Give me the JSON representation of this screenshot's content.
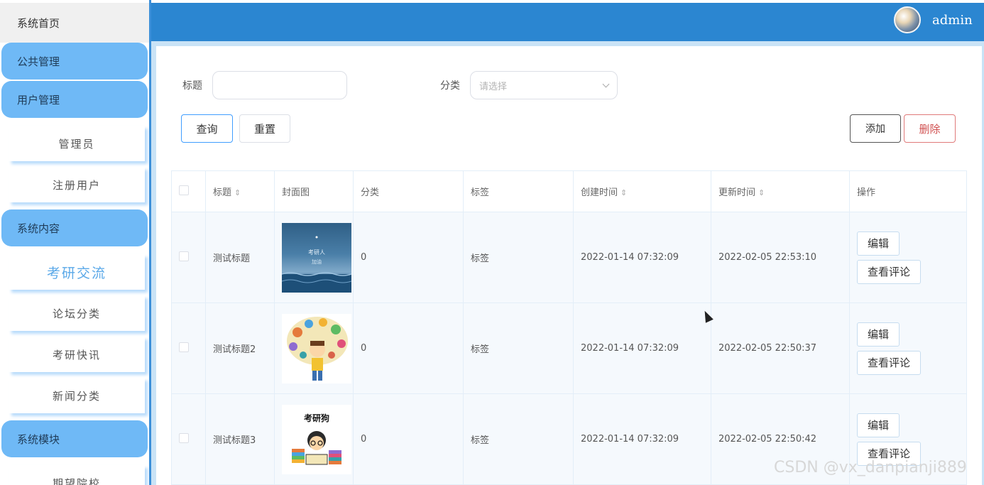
{
  "sidebar": {
    "home": "系统首页",
    "groups": {
      "public": "公共管理",
      "user": "用户管理",
      "content": "系统内容",
      "module": "系统模块"
    },
    "subs": {
      "admin": "管理员",
      "registered": "注册用户",
      "exchange": "考研交流",
      "forum_category": "论坛分类",
      "news_flash": "考研快讯",
      "news_category": "新闻分类",
      "target_school": "期望院校"
    }
  },
  "header": {
    "username": "admin"
  },
  "search": {
    "title_label": "标题",
    "title_value": "",
    "category_label": "分类",
    "category_placeholder": "请选择"
  },
  "toolbar": {
    "query": "查询",
    "reset": "重置",
    "add": "添加",
    "delete": "删除"
  },
  "table": {
    "headers": {
      "title": "标题",
      "cover": "封面图",
      "category": "分类",
      "tags": "标签",
      "created": "创建时间",
      "updated": "更新时间",
      "actions": "操作"
    },
    "sort_glyph": "⇕",
    "rows": [
      {
        "title": "测试标题",
        "cover_text": "考研人",
        "cover_sub": "加油",
        "category": "0",
        "tags": "标签",
        "created": "2022-01-14 07:32:09",
        "updated": "2022-02-05 22:53:10",
        "edit": "编辑",
        "view_comments": "查看评论"
      },
      {
        "title": "测试标题2",
        "category": "0",
        "tags": "标签",
        "created": "2022-01-14 07:32:09",
        "updated": "2022-02-05 22:50:37",
        "edit": "编辑",
        "view_comments": "查看评论"
      },
      {
        "title": "测试标题3",
        "cover_text": "考研狗",
        "category": "0",
        "tags": "标签",
        "created": "2022-01-14 07:32:09",
        "updated": "2022-02-05 22:50:42",
        "edit": "编辑",
        "view_comments": "查看评论"
      }
    ]
  },
  "watermark": "CSDN @vx_danpianji889",
  "colors": {
    "header": "#2b86d1",
    "sidebar_group": "#6fb9f6",
    "active_sub": "#5aa8e8",
    "delete": "#d05050"
  }
}
